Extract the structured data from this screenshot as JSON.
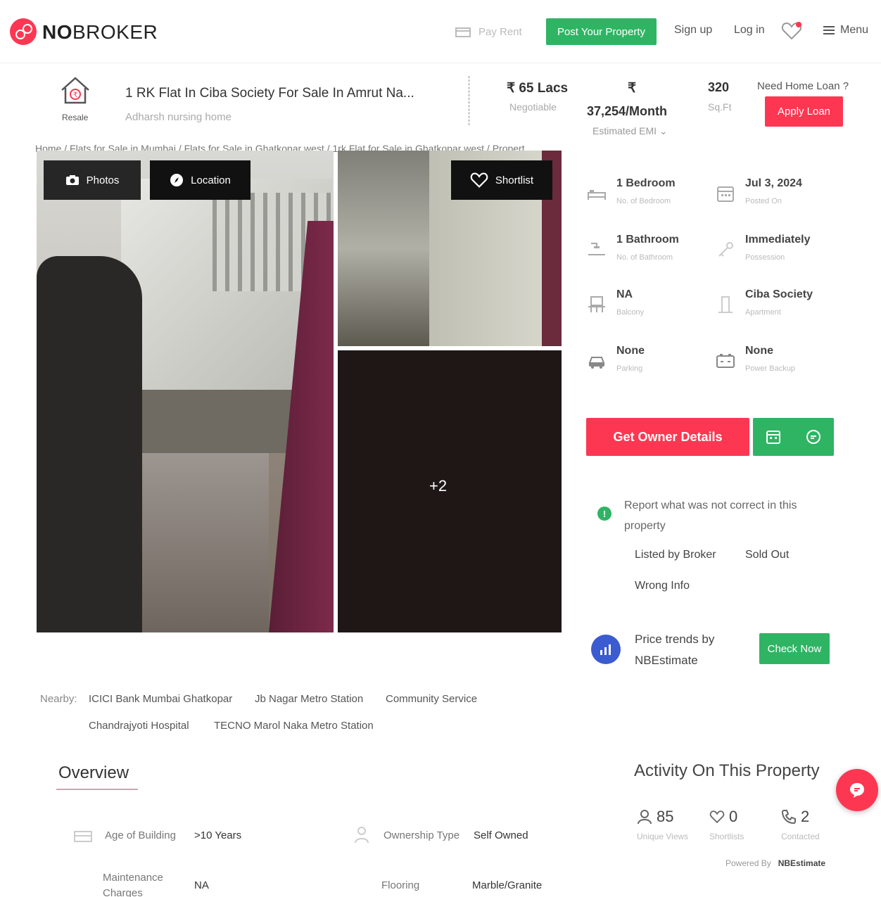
{
  "header": {
    "brand_bold": "NO",
    "brand_rest": "BROKER",
    "pay_rent": "Pay Rent",
    "post_property": "Post Your Property",
    "sign_up": "Sign up",
    "log_in": "Log in",
    "menu": "Menu"
  },
  "property": {
    "type_label": "Resale",
    "title": "1 RK Flat In Ciba Society For Sale In Amrut Na...",
    "subtitle": "Adharsh nursing home",
    "price": "₹ 65 Lacs",
    "price_note": "Negotiable",
    "emi_symbol": "₹",
    "emi": "37,254/Month",
    "emi_note": "Estimated EMI",
    "area": "320",
    "area_unit": "Sq.Ft",
    "loan_question": "Need Home Loan ?",
    "apply_loan": "Apply Loan"
  },
  "breadcrumb": "Home / Flats for Sale in Mumbai / Flats for Sale in Ghatkopar west / 1rk Flat for Sale in Ghatkopar west / Propert...",
  "gallery": {
    "photos": "Photos",
    "location": "Location",
    "shortlist": "Shortlist",
    "more": "+2"
  },
  "specs": [
    {
      "value": "1 Bedroom",
      "label": "No. of Bedroom",
      "icon": "bed-icon"
    },
    {
      "value": "Jul 3, 2024",
      "label": "Posted On",
      "icon": "calendar-icon"
    },
    {
      "value": "1 Bathroom",
      "label": "No. of Bathroom",
      "icon": "shower-icon"
    },
    {
      "value": "Immediately",
      "label": "Possession",
      "icon": "key-icon"
    },
    {
      "value": "NA",
      "label": "Balcony",
      "icon": "balcony-icon"
    },
    {
      "value": "Ciba Society",
      "label": "Apartment",
      "icon": "building-icon"
    },
    {
      "value": "None",
      "label": "Parking",
      "icon": "car-icon"
    },
    {
      "value": "None",
      "label": "Power Backup",
      "icon": "battery-icon"
    }
  ],
  "actions": {
    "owner_details": "Get Owner Details"
  },
  "report": {
    "text": "Report what was not correct in this property",
    "options": [
      "Listed by Broker",
      "Sold Out",
      "Wrong Info"
    ]
  },
  "price_trends": {
    "text_line1": "Price trends by",
    "text_line2": "NBEstimate",
    "button": "Check Now"
  },
  "nearby": {
    "label": "Nearby:",
    "items": [
      "ICICI Bank Mumbai Ghatkopar",
      "Jb Nagar Metro Station",
      "Community Service",
      "Chandrajyoti Hospital",
      "TECNO Marol Naka Metro Station"
    ]
  },
  "overview": {
    "title": "Overview",
    "rows": [
      {
        "label": "Age of Building",
        "value": ">10 Years"
      },
      {
        "label": "Ownership Type",
        "value": "Self Owned"
      },
      {
        "label": "Maintenance Charges",
        "value": "NA"
      },
      {
        "label": "Flooring",
        "value": "Marble/Granite"
      }
    ]
  },
  "activity": {
    "title": "Activity On This Property",
    "stats": [
      {
        "value": "85",
        "label": "Unique Views"
      },
      {
        "value": "0",
        "label": "Shortlists"
      },
      {
        "value": "2",
        "label": "Contacted"
      }
    ],
    "powered_by": "Powered By",
    "powered_brand": "NBEstimate"
  },
  "colors": {
    "brand_red": "#fd3752",
    "action_green": "#2fb464"
  }
}
